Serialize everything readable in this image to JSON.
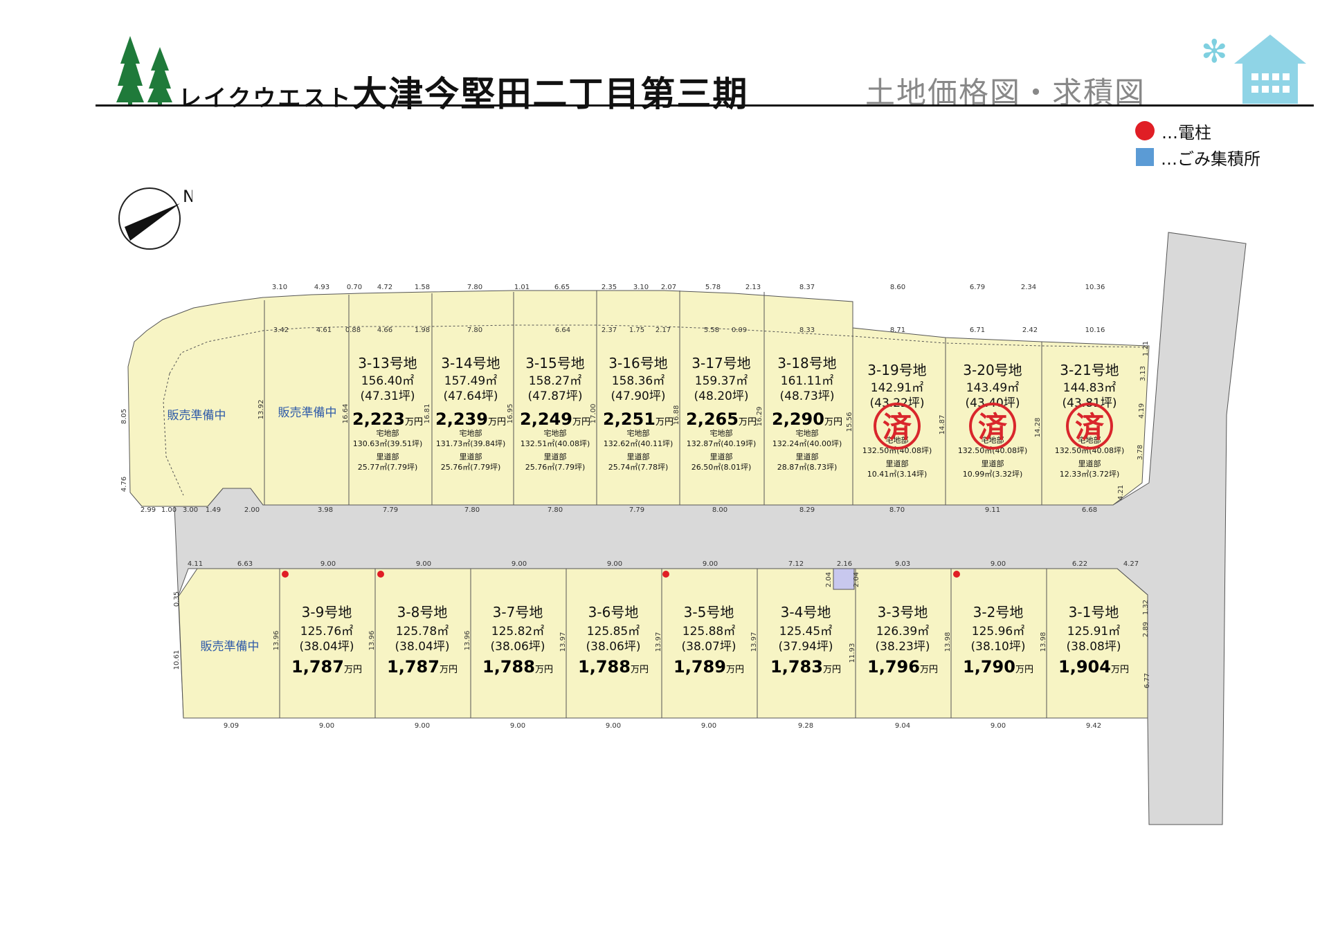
{
  "title_prefix": "レイクウエスト",
  "title_main": "大津今堅田二丁目第三期",
  "map_title": "土地価格図・求積図",
  "legend": [
    {
      "icon": "pole-dot-icon",
      "color": "#e01e25",
      "label": "…電柱"
    },
    {
      "icon": "garbage-square-icon",
      "color": "#5b9bd5",
      "label": "…ごみ集積所"
    }
  ],
  "compass_label": "N",
  "sold_mark": "済",
  "preparing_label": "販売準備中",
  "sub_labels": {
    "house": "宅地部",
    "road": "里道部"
  },
  "colors": {
    "lot_fill": "#f7f4c4",
    "road": "#d9d9d9",
    "sold": "#d9262c",
    "preparing": "#2e5aa8"
  },
  "upper_lots": [
    {
      "name": "3-13号地",
      "area": "156.40㎡",
      "tsubo": "(47.31坪)",
      "price": "2,223",
      "unit": "万円",
      "house": "130.63㎡(39.51坪)",
      "road": "25.77㎡(7.79坪)"
    },
    {
      "name": "3-14号地",
      "area": "157.49㎡",
      "tsubo": "(47.64坪)",
      "price": "2,239",
      "unit": "万円",
      "house": "131.73㎡(39.84坪)",
      "road": "25.76㎡(7.79坪)"
    },
    {
      "name": "3-15号地",
      "area": "158.27㎡",
      "tsubo": "(47.87坪)",
      "price": "2,249",
      "unit": "万円",
      "house": "132.51㎡(40.08坪)",
      "road": "25.76㎡(7.79坪)"
    },
    {
      "name": "3-16号地",
      "area": "158.36㎡",
      "tsubo": "(47.90坪)",
      "price": "2,251",
      "unit": "万円",
      "house": "132.62㎡(40.11坪)",
      "road": "25.74㎡(7.78坪)"
    },
    {
      "name": "3-17号地",
      "area": "159.37㎡",
      "tsubo": "(48.20坪)",
      "price": "2,265",
      "unit": "万円",
      "house": "132.87㎡(40.19坪)",
      "road": "26.50㎡(8.01坪)"
    },
    {
      "name": "3-18号地",
      "area": "161.11㎡",
      "tsubo": "(48.73坪)",
      "price": "2,290",
      "unit": "万円",
      "house": "132.24㎡(40.00坪)",
      "road": "28.87㎡(8.73坪)"
    },
    {
      "name": "3-19号地",
      "area": "142.91㎡",
      "tsubo": "(43.22坪)",
      "price": "",
      "unit": "",
      "house": "132.50㎡(40.08坪)",
      "road": "10.41㎡(3.14坪)",
      "sold": true
    },
    {
      "name": "3-20号地",
      "area": "143.49㎡",
      "tsubo": "(43.40坪)",
      "price": "",
      "unit": "",
      "house": "132.50㎡(40.08坪)",
      "road": "10.99㎡(3.32坪)",
      "sold": true
    },
    {
      "name": "3-21号地",
      "area": "144.83㎡",
      "tsubo": "(43.81坪)",
      "price": "",
      "unit": "",
      "house": "132.50㎡(40.08坪)",
      "road": "12.33㎡(3.72坪)",
      "sold": true
    }
  ],
  "lower_lots": [
    {
      "name": "3-9号地",
      "area": "125.76㎡",
      "tsubo": "(38.04坪)",
      "price": "1,787",
      "unit": "万円"
    },
    {
      "name": "3-8号地",
      "area": "125.78㎡",
      "tsubo": "(38.04坪)",
      "price": "1,787",
      "unit": "万円"
    },
    {
      "name": "3-7号地",
      "area": "125.82㎡",
      "tsubo": "(38.06坪)",
      "price": "1,788",
      "unit": "万円"
    },
    {
      "name": "3-6号地",
      "area": "125.85㎡",
      "tsubo": "(38.06坪)",
      "price": "1,788",
      "unit": "万円"
    },
    {
      "name": "3-5号地",
      "area": "125.88㎡",
      "tsubo": "(38.07坪)",
      "price": "1,789",
      "unit": "万円"
    },
    {
      "name": "3-4号地",
      "area": "125.45㎡",
      "tsubo": "(37.94坪)",
      "price": "1,783",
      "unit": "万円"
    },
    {
      "name": "3-3号地",
      "area": "126.39㎡",
      "tsubo": "(38.23坪)",
      "price": "1,796",
      "unit": "万円"
    },
    {
      "name": "3-2号地",
      "area": "125.96㎡",
      "tsubo": "(38.10坪)",
      "price": "1,790",
      "unit": "万円"
    },
    {
      "name": "3-1号地",
      "area": "125.91㎡",
      "tsubo": "(38.08坪)",
      "price": "1,904",
      "unit": "万円"
    }
  ],
  "dims": {
    "upper_top": [
      "3.10",
      "4.93",
      "0.70",
      "4.72",
      "1.58",
      "7.80",
      "1.01",
      "6.65",
      "2.35",
      "3.10",
      "2.07",
      "5.78",
      "2.13",
      "8.37",
      "8.60",
      "6.79",
      "2.34",
      "10.36"
    ],
    "upper_inner": [
      "3.42",
      "4.61",
      "0.88",
      "4.66",
      "1.98",
      "7.80",
      "6.64",
      "2.37",
      "1.75",
      "2.17",
      "5.58",
      "0.09",
      "8.33",
      "8.71",
      "6.71",
      "2.42",
      "10.16"
    ],
    "upper_bottom": [
      "2.99",
      "1.00",
      "3.00",
      "1.49",
      "2.00",
      "3.98",
      "7.79",
      "7.80",
      "7.80",
      "7.79",
      "8.00",
      "8.29",
      "8.70",
      "9.11",
      "6.68"
    ],
    "upper_sides": [
      "8.05",
      "4.76",
      "13.92",
      "16.64",
      "16.81",
      "16.95",
      "17.00",
      "16.88",
      "16.29",
      "15.56",
      "14.87",
      "14.28",
      "4.19",
      "3.78",
      "1.21",
      "3.13",
      "4.21"
    ],
    "lower_top": [
      "6.63",
      "9.00",
      "9.00",
      "9.00",
      "9.00",
      "9.00",
      "7.12",
      "2.16",
      "9.03",
      "9.00",
      "6.22",
      "4.11",
      "4.27"
    ],
    "lower_bottom": [
      "9.09",
      "9.00",
      "9.00",
      "9.00",
      "9.00",
      "9.00",
      "9.28",
      "9.04",
      "9.00",
      "9.42"
    ],
    "lower_sides": [
      "10.61",
      "0.35",
      "13.96",
      "13.96",
      "13.96",
      "13.97",
      "13.97",
      "13.97",
      "11.93",
      "13.98",
      "13.98",
      "1.32",
      "2.89",
      "6.77",
      "2.04",
      "2.04"
    ]
  }
}
